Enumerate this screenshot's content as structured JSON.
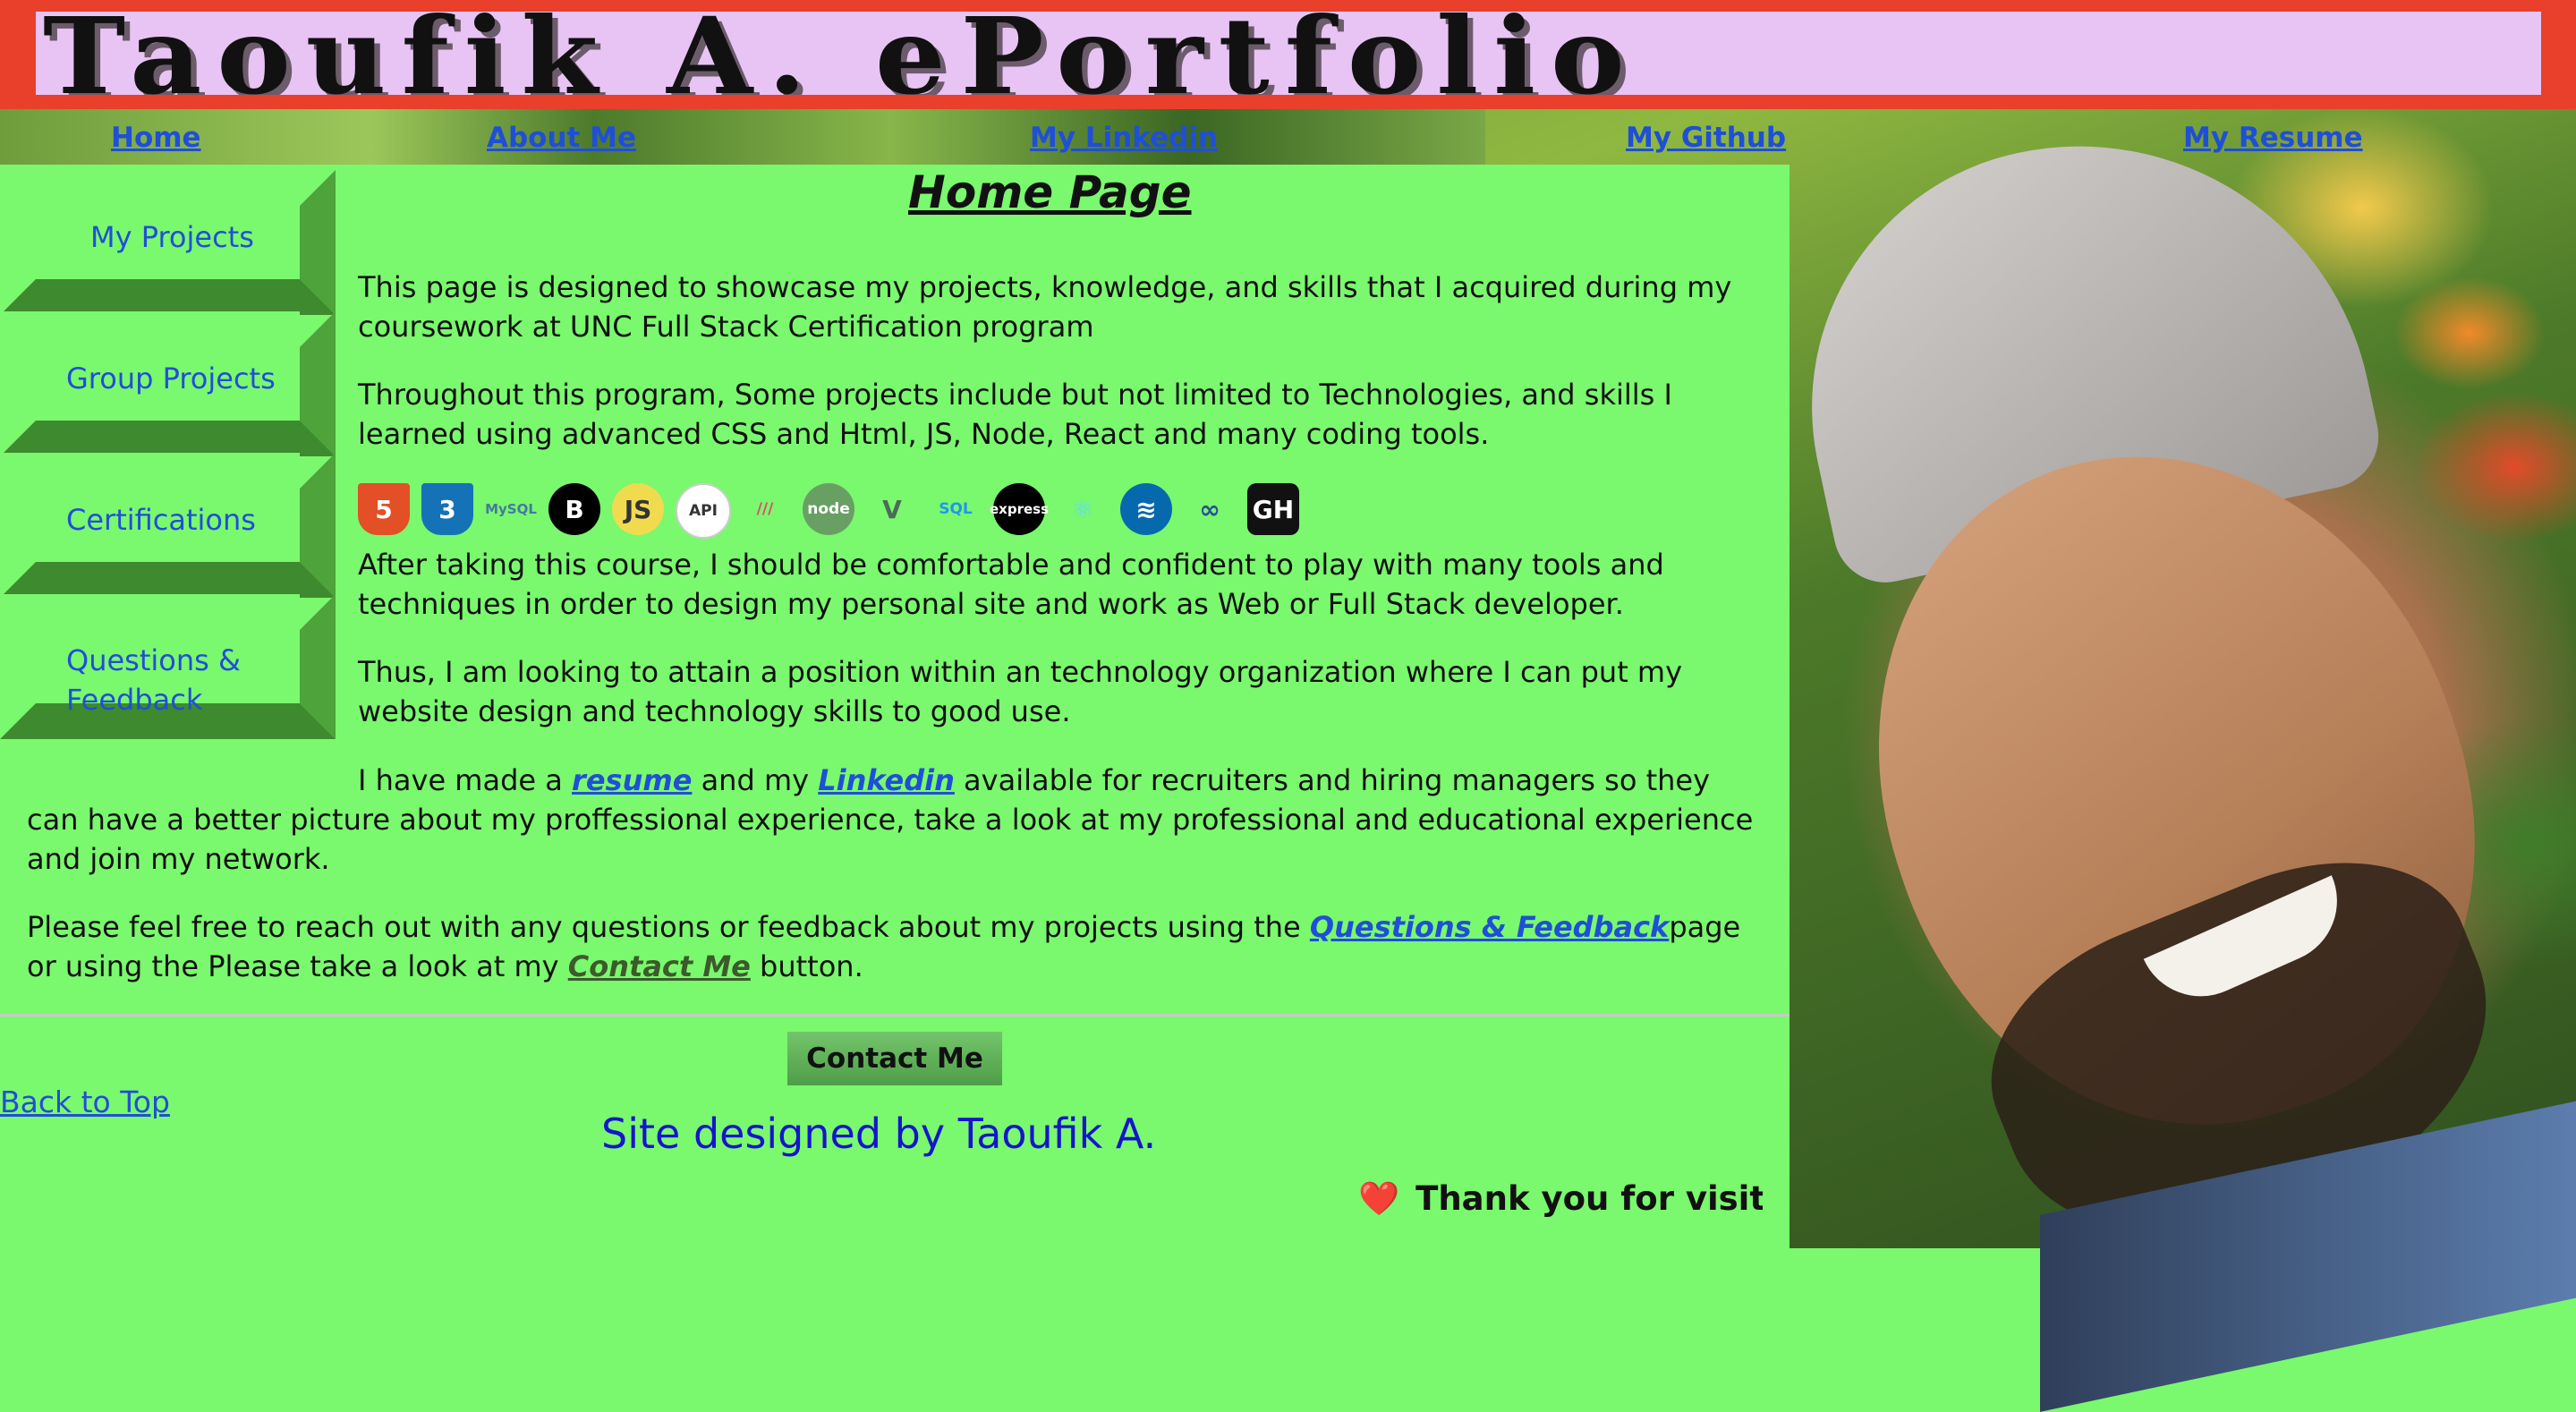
{
  "banner": {
    "title": "Taoufik A. ePortfolio"
  },
  "nav": {
    "items": [
      "Home",
      "About Me",
      "My Linkedin",
      "My Github",
      "My Resume"
    ]
  },
  "sidebar": {
    "items": [
      {
        "label": "My Projects"
      },
      {
        "label": "Group Projects"
      },
      {
        "label": "Certifications"
      },
      {
        "label": "Questions &"
      },
      {
        "label": "Feedback"
      }
    ]
  },
  "main": {
    "heading": "Home Page",
    "p1": {
      "line1": "This page is designed to showcase my projects, knowledge, and skills that I acquired during my",
      "line2": "coursework at UNC Full Stack Certification program"
    },
    "p2": {
      "line1": "Throughout this program, Some projects include but not limited to Technologies, and skills I",
      "line2": "learned using advanced CSS and Html, JS, Node, React and many coding tools."
    },
    "tech_icons": [
      {
        "text": "5",
        "name": "html5-icon",
        "color": "#e34f26"
      },
      {
        "text": "3",
        "name": "css3-icon",
        "color": "#1572b6"
      },
      {
        "text": "MySQL",
        "name": "mysql-icon",
        "color": "#4479a1"
      },
      {
        "text": "B",
        "name": "bootstrap-icon",
        "color": "#000000"
      },
      {
        "text": "JS",
        "name": "javascript-icon",
        "color": "#f0db4f"
      },
      {
        "text": "API",
        "name": "api-icon",
        "color": "#ffffff"
      },
      {
        "text": "///",
        "name": "insomnia-icon",
        "color": "#e04a6d"
      },
      {
        "text": "node",
        "name": "nodejs-icon",
        "color": "#68a063"
      },
      {
        "text": "V",
        "name": "vue-icon",
        "color": "#4a6b5a"
      },
      {
        "text": "SQL",
        "name": "sql-icon",
        "color": "#2196f3"
      },
      {
        "text": "express",
        "name": "express-icon",
        "color": "#000000"
      },
      {
        "text": "⚛",
        "name": "react-icon",
        "color": "#61dafb"
      },
      {
        "text": "≋",
        "name": "jquery-icon",
        "color": "#0769ad"
      },
      {
        "text": "∞",
        "name": "graphql-icon",
        "color": "#2b4d99"
      },
      {
        "text": "GH",
        "name": "github-icon",
        "color": "#111111"
      }
    ],
    "p3": {
      "line1": "After taking this course, I should be comfortable and confident to play with many tools and",
      "line2": "techniques in order to design my personal site and work as Web or Full Stack developer."
    },
    "p4": {
      "line1": "Thus, I am looking to attain a position within an technology organization where I can put my",
      "line2": "website design and technology skills to good use."
    },
    "p5": {
      "pre": "I have made a ",
      "link_resume": "resume",
      "mid": " and my ",
      "link_linkedin": "Linkedin",
      "post": " available for recruiters and hiring managers so they",
      "line2": "can have a better picture about my proffessional experience, take a look at my professional and educational experience",
      "line3": "and join my network."
    },
    "p6": {
      "pre": "Please feel free to reach out with any questions or feedback about my projects using the ",
      "link_qf": "Questions & Feedback",
      "post": "page",
      "line2_pre": "or using the Please take a look at my ",
      "link_contact": "Contact Me",
      "line2_post": " button."
    }
  },
  "footer": {
    "contact_button": "Contact Me",
    "back_to_top": "Back to Top",
    "designed_by": "Site designed by Taoufik A.",
    "thanks_marquee": "Thank you for visiti",
    "heart": "❤️"
  },
  "colors": {
    "banner_red": "#e8402a",
    "banner_lavender": "#e8c4f4",
    "page_green": "#7af86e",
    "link_blue": "#1f4fd6"
  }
}
